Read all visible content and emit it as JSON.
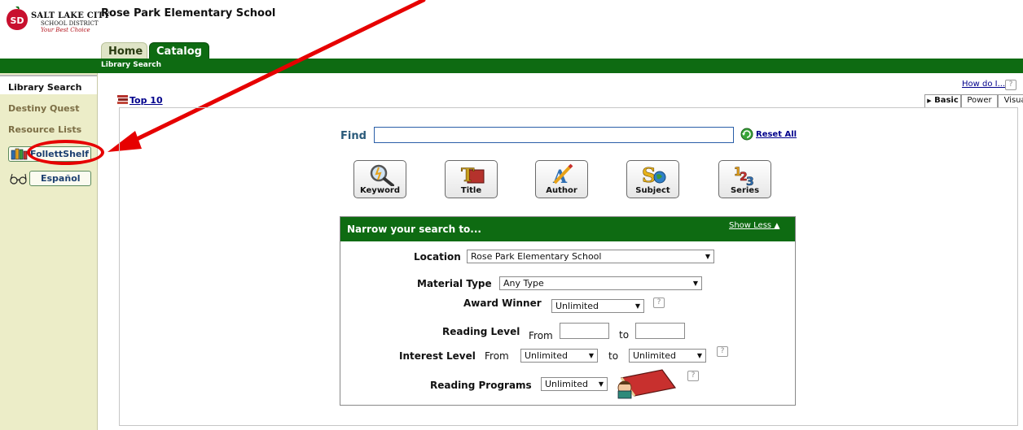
{
  "district": {
    "line1": "SALT LAKE CITY",
    "line2": "SCHOOL DISTRICT",
    "line3": "Your Best Choice",
    "mark": "SD"
  },
  "school_name": "Rose Park Elementary School",
  "tabs": [
    {
      "label": "Home"
    },
    {
      "label": "Catalog"
    }
  ],
  "subtab_label": "Library Search",
  "sidebar": {
    "items": [
      {
        "label": "Library Search"
      },
      {
        "label": "Destiny Quest"
      },
      {
        "label": "Resource Lists"
      }
    ],
    "buttons": [
      {
        "label": "FollettShelf",
        "icon": "books-icon"
      },
      {
        "label": "Español",
        "icon": "glasses-icon"
      }
    ]
  },
  "help": {
    "how_do_i": "How do I...",
    "q": "?"
  },
  "mode_tabs": [
    {
      "label": "Basic"
    },
    {
      "label": "Power"
    },
    {
      "label": "Visual"
    }
  ],
  "top10": "Top 10",
  "find": {
    "label": "Find",
    "value": "",
    "reset_label": "Reset All"
  },
  "search_buttons": [
    {
      "label": "Keyword",
      "icon": "magnifier-icon"
    },
    {
      "label": "Title",
      "icon": "title-icon"
    },
    {
      "label": "Author",
      "icon": "pencil-icon"
    },
    {
      "label": "Subject",
      "icon": "subject-icon"
    },
    {
      "label": "Series",
      "icon": "numbers-icon"
    }
  ],
  "narrow": {
    "title": "Narrow your search to...",
    "show_less": "Show Less",
    "location_label": "Location",
    "location_value": "Rose Park Elementary School",
    "material_label": "Material Type",
    "material_value": "Any Type",
    "award_label": "Award Winner",
    "award_value": "Unlimited",
    "reading_level_label": "Reading Level",
    "from": "From",
    "to": "to",
    "interest_label": "Interest Level",
    "interest_from_value": "Unlimited",
    "interest_to_value": "Unlimited",
    "programs_label": "Reading Programs",
    "programs_value": "Unlimited"
  },
  "colors": {
    "brand_green": "#0e6b12",
    "sidebar_bg": "#ecedc8",
    "link": "#00008b",
    "highlight_red": "#e60000"
  }
}
